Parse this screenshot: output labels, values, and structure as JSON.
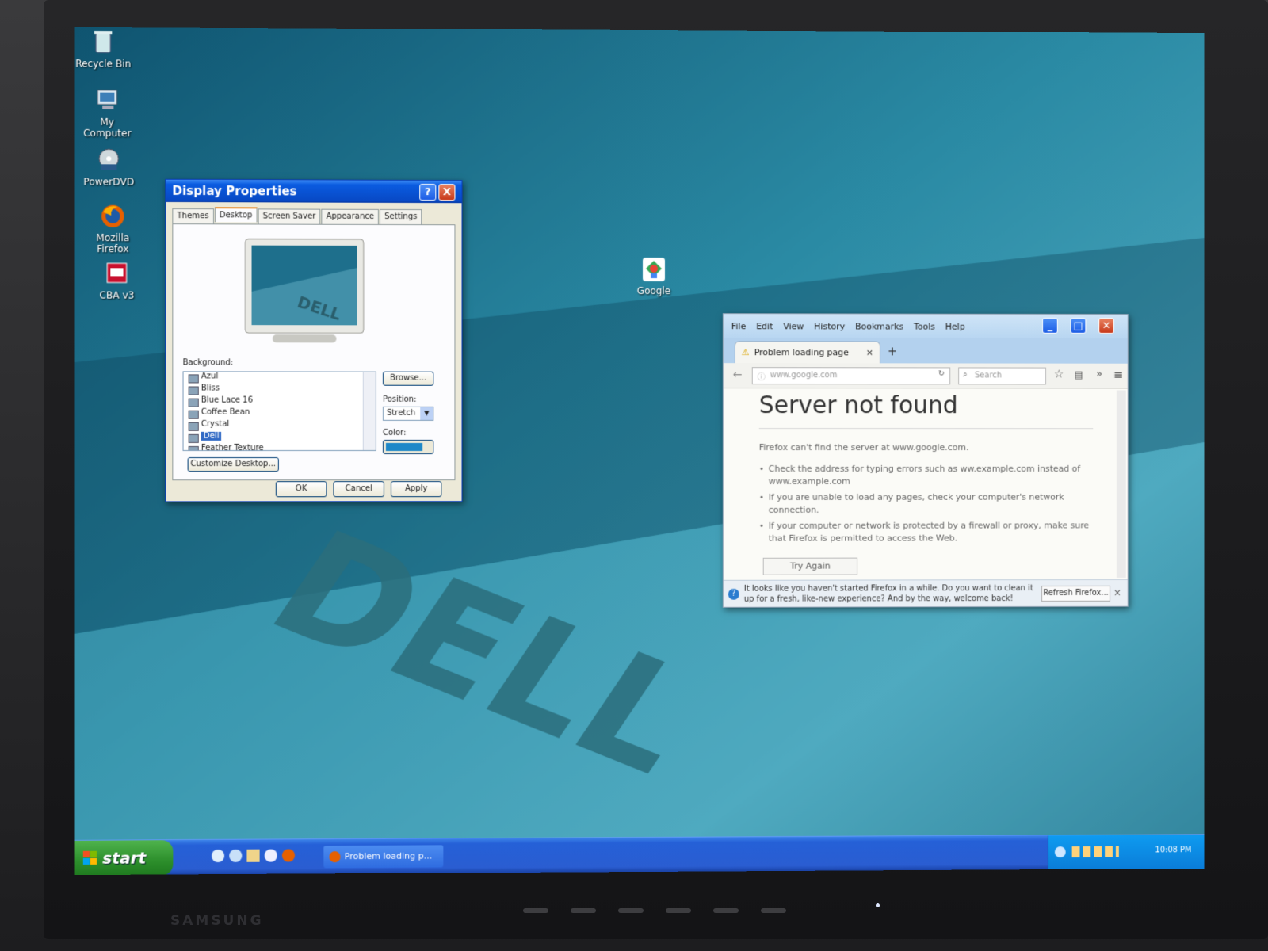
{
  "desktop": {
    "icons": [
      {
        "label": "Recycle Bin"
      },
      {
        "label": "My Computer"
      },
      {
        "label": "PowerDVD"
      },
      {
        "label": "Mozilla Firefox"
      },
      {
        "label": "CBA v3"
      },
      {
        "label": "Google"
      }
    ],
    "wallpaper_text": "DELL"
  },
  "display_props": {
    "title": "Display Properties",
    "help_glyph": "?",
    "close_glyph": "X",
    "tabs": [
      "Themes",
      "Desktop",
      "Screen Saver",
      "Appearance",
      "Settings"
    ],
    "active_tab": "Desktop",
    "background_label": "Background:",
    "backgrounds": [
      "Azul",
      "Bliss",
      "Blue Lace 16",
      "Coffee Bean",
      "Crystal",
      "Dell",
      "Feather Texture"
    ],
    "selected_background": "Dell",
    "browse_label": "Browse...",
    "position_label": "Position:",
    "position_value": "Stretch",
    "color_label": "Color:",
    "color_value": "#1e88c8",
    "customize_label": "Customize Desktop...",
    "ok_label": "OK",
    "cancel_label": "Cancel",
    "apply_label": "Apply"
  },
  "firefox": {
    "menu": [
      "File",
      "Edit",
      "View",
      "History",
      "Bookmarks",
      "Tools",
      "Help"
    ],
    "tab_title": "Problem loading page",
    "tab_close": "×",
    "new_tab": "+",
    "url": "www.google.com",
    "search_placeholder": "Search",
    "overflow": "»",
    "error_title": "Server not found",
    "error_lead": "Firefox can't find the server at www.google.com.",
    "bullets": [
      "Check the address for typing errors such as ww.example.com instead of www.example.com",
      "If you are unable to load any pages, check your computer's network connection.",
      "If your computer or network is protected by a firewall or proxy, make sure that Firefox is permitted to access the Web."
    ],
    "try_again_label": "Try Again",
    "notice_text": "It looks like you haven't started Firefox in a while. Do you want to clean it up for a fresh, like-new experience? And by the way, welcome back!",
    "refresh_label": "Refresh Firefox...",
    "notice_close": "×"
  },
  "taskbar": {
    "start_label": "start",
    "task_label": "Problem loading p...",
    "clock": "10:08 PM"
  },
  "monitor": {
    "brand": "SAMSUNG"
  }
}
